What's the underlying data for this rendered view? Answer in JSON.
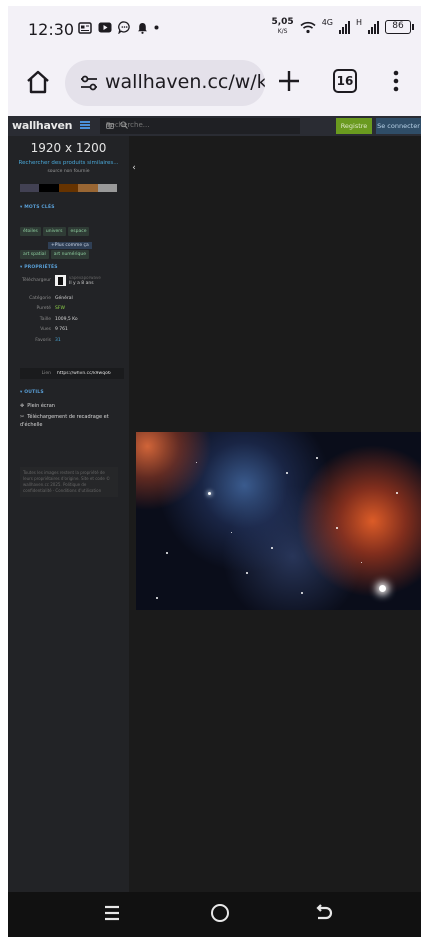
{
  "status_bar": {
    "time": "12:30",
    "net_speed_value": "5,05",
    "net_speed_unit": "K/S",
    "mobile_net_1": "4G",
    "mobile_net_2": "H",
    "battery": "86"
  },
  "browser": {
    "url": "wallhaven.cc/w/k'",
    "tab_count": "16"
  },
  "site": {
    "logo": "wallhaven",
    "search_placeholder": "Recherche...",
    "register_label": "Registre",
    "login_label": "Se connecter"
  },
  "sidebar": {
    "resolution": "1920 x 1200",
    "similar_link": "Rechercher des produits similaires...",
    "no_source": "source non fournie",
    "palette": [
      "#424153",
      "#000000",
      "#663300",
      "#996633",
      "#999999"
    ],
    "tags_title": "▾ MOTS CLÉS",
    "tags": [
      "étoiles",
      "univers",
      "espace",
      "art spatial",
      "art numérique"
    ],
    "add_tag": "+Plus comme ça",
    "properties_title": "▾ PROPRIÉTÉS",
    "uploader_label": "Téléchargeur",
    "uploader_name": "vapevaporwave",
    "uploader_time": "Il y a 8 ans",
    "props": [
      {
        "k": "Catégorie",
        "v": "Général"
      },
      {
        "k": "Pureté",
        "v": "SFW"
      },
      {
        "k": "Taille",
        "v": "1009,5 Ko"
      },
      {
        "k": "Vues",
        "v": "9 761"
      },
      {
        "k": "Favoris",
        "v": "31"
      }
    ],
    "link_label": "Lien",
    "link_value": "https://whvn.cc/k9wqo6",
    "tools_title": "▾ OUTILS",
    "tool_fullscreen": "Plein écran",
    "tool_crop": "Téléchargement de recadrage et d'échelle",
    "legal": "Toutes les images restent la propriété de leurs propriétaires d'origine. Site et code © wallhaven.cc 2025. Politique de confidentialité · Conditions d'utilisation"
  },
  "colors": {
    "site_bg": "#1b1b1b",
    "register_green": "#6a9a1f",
    "login_blue": "#2f4d67",
    "accent_blue": "#4aa8d8"
  }
}
